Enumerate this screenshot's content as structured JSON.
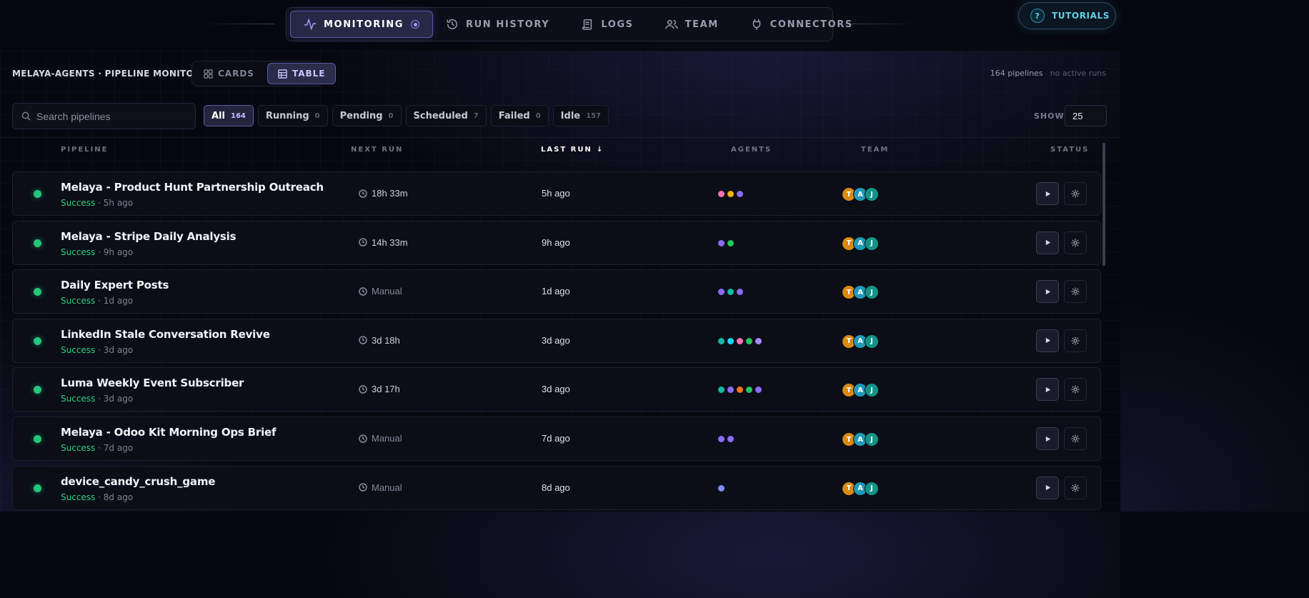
{
  "nav": {
    "tabs": [
      {
        "label": "MONITORING",
        "icon": "activity-icon"
      },
      {
        "label": "RUN HISTORY",
        "icon": "history-icon"
      },
      {
        "label": "LOGS",
        "icon": "logs-icon"
      },
      {
        "label": "TEAM",
        "icon": "team-icon"
      },
      {
        "label": "CONNECTORS",
        "icon": "plug-icon"
      }
    ],
    "tutorials_label": "TUTORIALS",
    "help_glyph": "?"
  },
  "header": {
    "title": "MELAYA-AGENTS · PIPELINE MONITOR",
    "views": [
      "CARDS",
      "TABLE"
    ],
    "pipeline_count": "164 pipelines",
    "active_runs": "no active runs"
  },
  "filters": {
    "search_placeholder": "Search pipelines",
    "chips": [
      {
        "label": "All",
        "count": "164"
      },
      {
        "label": "Running",
        "count": "0"
      },
      {
        "label": "Pending",
        "count": "0"
      },
      {
        "label": "Scheduled",
        "count": "7"
      },
      {
        "label": "Failed",
        "count": "0"
      },
      {
        "label": "Idle",
        "count": "157"
      }
    ],
    "show_label": "SHOW",
    "show_value": "25"
  },
  "table": {
    "columns": {
      "pipeline": "PIPELINE",
      "next_run": "NEXT RUN",
      "last_run": "LAST RUN",
      "sort_arrow": "↓",
      "agents": "AGENTS",
      "team": "TEAM",
      "status": "STATUS"
    },
    "rows": [
      {
        "name": "Melaya - Product Hunt Partnership Outreach",
        "status": "Success",
        "ago": "· 5h ago",
        "next_run": "18h 33m",
        "last_run": "5h ago",
        "agents": [
          "#f472b6",
          "#eab308",
          "#8b6cf6"
        ]
      },
      {
        "name": "Melaya - Stripe Daily Analysis",
        "status": "Success",
        "ago": "· 9h ago",
        "next_run": "14h 33m",
        "last_run": "9h ago",
        "agents": [
          "#8b6cf6",
          "#22c55e"
        ]
      },
      {
        "name": "Daily Expert Posts",
        "status": "Success",
        "ago": "· 1d ago",
        "next_run": "Manual",
        "last_run": "1d ago",
        "agents": [
          "#8b6cf6",
          "#14b8a6",
          "#8b6cf6"
        ]
      },
      {
        "name": "LinkedIn Stale Conversation Revive",
        "status": "Success",
        "ago": "· 3d ago",
        "next_run": "3d 18h",
        "last_run": "3d ago",
        "agents": [
          "#14b8a6",
          "#22d3ee",
          "#f472b6",
          "#22c55e",
          "#a78bfa"
        ]
      },
      {
        "name": "Luma Weekly Event Subscriber",
        "status": "Success",
        "ago": "· 3d ago",
        "next_run": "3d 17h",
        "last_run": "3d ago",
        "agents": [
          "#14b8a6",
          "#8b6cf6",
          "#f97316",
          "#22c55e",
          "#8b6cf6"
        ]
      },
      {
        "name": "Melaya - Odoo Kit Morning Ops Brief",
        "status": "Success",
        "ago": "· 7d ago",
        "next_run": "Manual",
        "last_run": "7d ago",
        "agents": [
          "#8b6cf6",
          "#8b6cf6"
        ]
      },
      {
        "name": "device_candy_crush_game",
        "status": "Success",
        "ago": "· 8d ago",
        "next_run": "Manual",
        "last_run": "8d ago",
        "agents": [
          "#818cf8"
        ]
      }
    ],
    "team": [
      {
        "initial": "T",
        "color": "#d98a0f"
      },
      {
        "initial": "A",
        "color": "#1f9ab8"
      },
      {
        "initial": "J",
        "color": "#139487"
      }
    ]
  },
  "colors": {
    "accent": "#5b5aa6",
    "success": "#22c77a",
    "tutorials": "#5fd0e4"
  }
}
